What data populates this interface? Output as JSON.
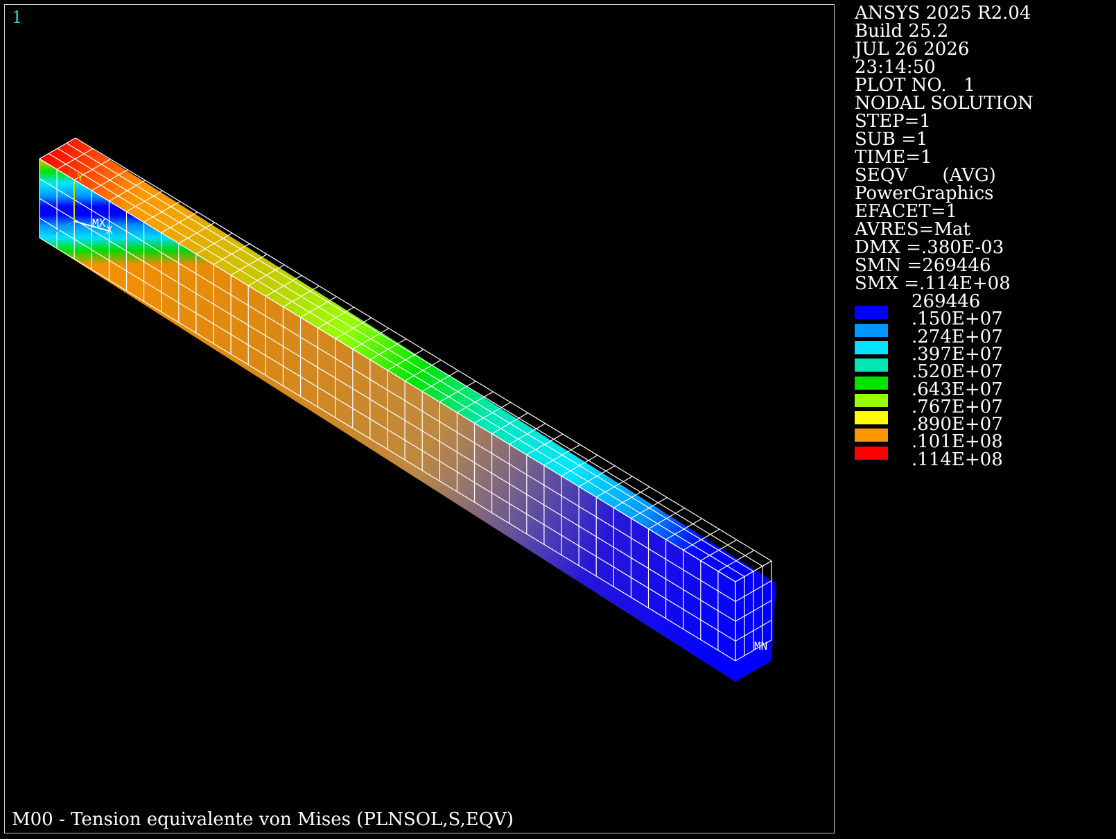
{
  "window": {
    "number": "1",
    "caption": "M00 - Tension equivalente von Mises (PLNSOL,S,EQV)"
  },
  "info_lines": [
    "ANSYS 2025 R2.04",
    "Build 25.2",
    "JUL 26 2026",
    "23:14:50",
    "PLOT NO.   1",
    "NODAL SOLUTION",
    "STEP=1",
    "SUB =1",
    "TIME=1",
    "SEQV      (AVG)",
    "PowerGraphics",
    "EFACET=1",
    "AVRES=Mat",
    "DMX =.380E-03",
    "SMN =269446",
    "SMX =.114E+08"
  ],
  "legend": {
    "min_label": "269446",
    "bands": [
      {
        "color": "#0000ff",
        "label": ".150E+07"
      },
      {
        "color": "#0096ff",
        "label": ".274E+07"
      },
      {
        "color": "#00e5ff",
        "label": ".397E+07"
      },
      {
        "color": "#00e6b4",
        "label": ".520E+07"
      },
      {
        "color": "#00e400",
        "label": ".643E+07"
      },
      {
        "color": "#96ff00",
        "label": ".767E+07"
      },
      {
        "color": "#ffff00",
        "label": ".890E+07"
      },
      {
        "color": "#ff9600",
        "label": ".101E+08"
      },
      {
        "color": "#ff0000",
        "label": ".114E+08"
      }
    ]
  },
  "markers": {
    "max": "MX",
    "min": "MN",
    "triad_y": "Y",
    "triad_x": "X"
  },
  "colors": {
    "window_number": "#2ad3cf",
    "mesh_lines": "#ffffff",
    "triad_y": "#d8d800",
    "triad_x": "#ffffff",
    "triad_z": "#2a9fd6"
  }
}
